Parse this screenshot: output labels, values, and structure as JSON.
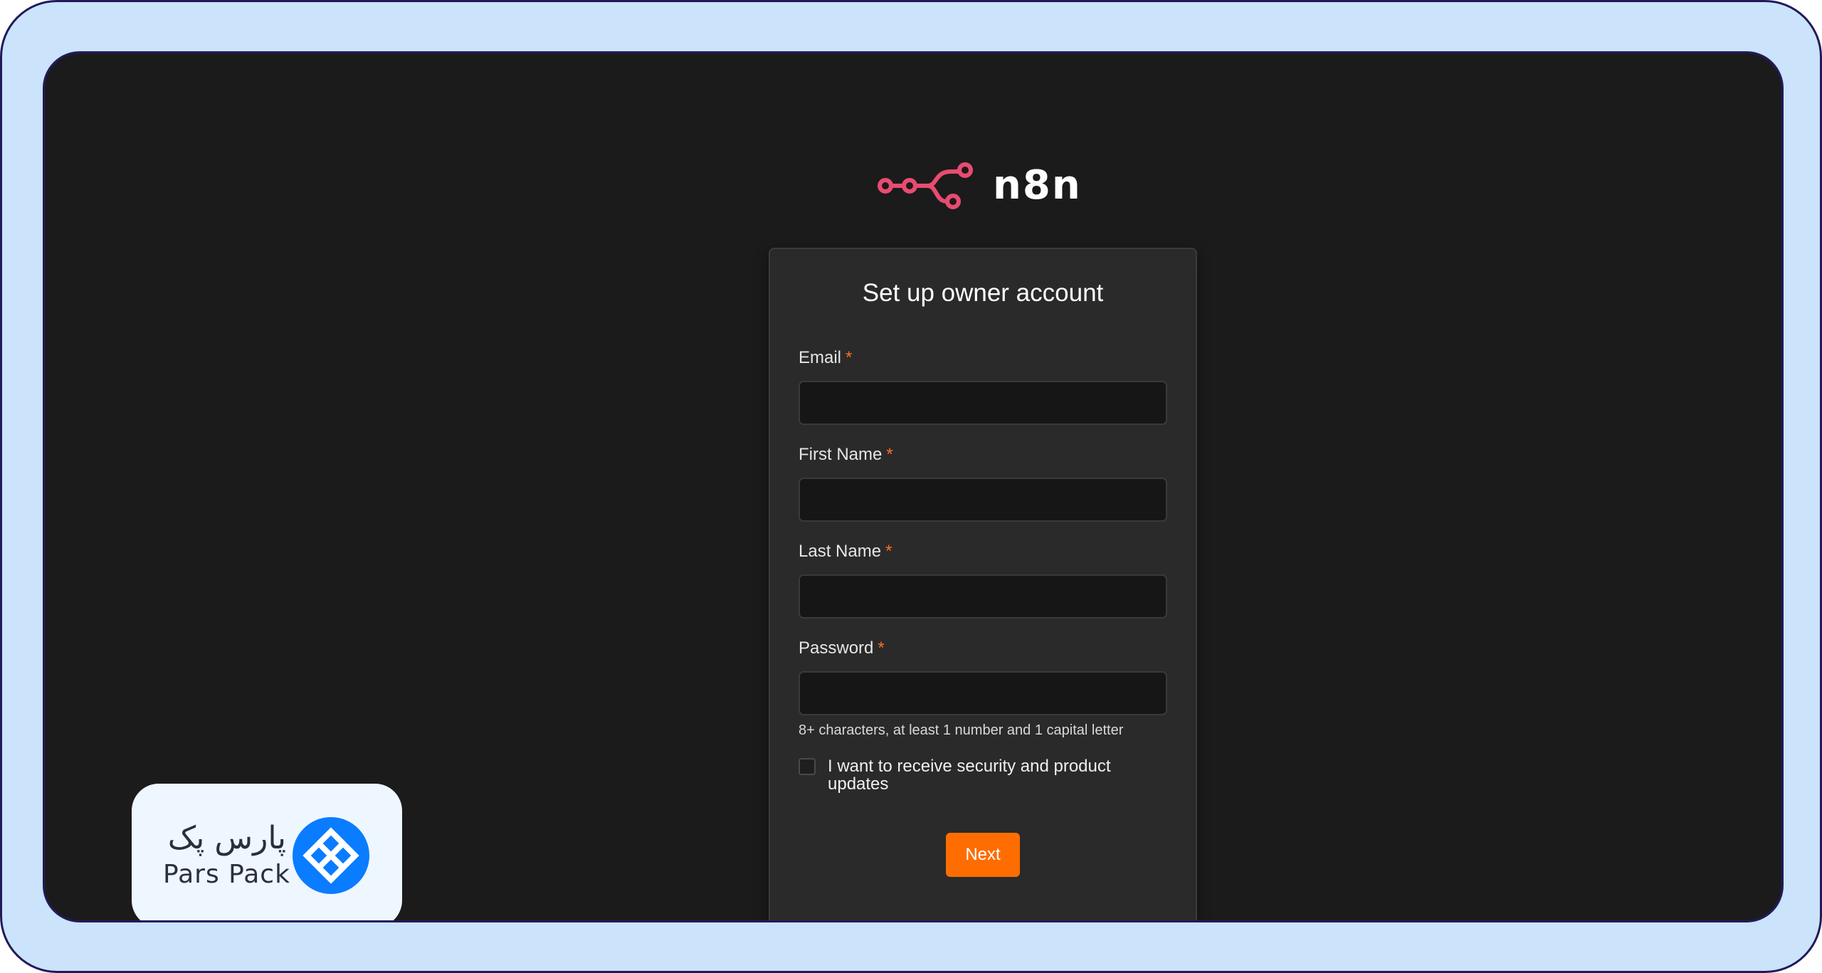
{
  "brand": {
    "name": "n8n",
    "logo_icon": "n8n-workflow-logo",
    "logo_color": "#ea4b71"
  },
  "form": {
    "title": "Set up owner account",
    "required_marker": "*",
    "fields": [
      {
        "label": "Email",
        "value": "",
        "type": "email"
      },
      {
        "label": "First Name",
        "value": "",
        "type": "text"
      },
      {
        "label": "Last Name",
        "value": "",
        "type": "text"
      },
      {
        "label": "Password",
        "value": "",
        "type": "password"
      }
    ],
    "password_hint": "8+ characters, at least 1 number and 1 capital letter",
    "updates_checkbox": {
      "label": "I want to receive security and product updates",
      "checked": false
    },
    "next_label": "Next"
  },
  "partner": {
    "name_fa": "پارس پک",
    "name_en": "Pars Pack",
    "icon": "parspack-logo-icon",
    "color": "#0a7cff"
  },
  "colors": {
    "accent": "#ff6d00",
    "required": "#ff6d2a",
    "frame_bg": "#cbe3fb",
    "frame_border": "#221a5a",
    "screen_bg": "#1b1b1b",
    "card_bg": "#2a2a2a"
  }
}
